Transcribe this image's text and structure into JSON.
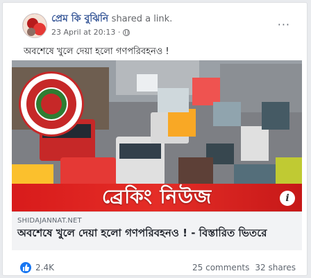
{
  "post": {
    "author": "প্রেম কি বুঝিনি",
    "action": "shared a link.",
    "date": "23 April at 20:13 ·",
    "menu_label": "···",
    "text": "অবশেষে খুলে দেয়া হলো গণপরিবহনও !"
  },
  "link": {
    "image_banner": "ব্রেকিং নিউজ",
    "info_label": "i",
    "domain": "SHIDAJANNAT.NET",
    "title": "অবশেষে খুলে দেয়া হলো গণপরিবহনও ! - বিস্তারিত ভিতরে"
  },
  "footer": {
    "likes": "2.4K",
    "comments": "25 comments",
    "shares": "32 shares"
  },
  "colors": {
    "author": "#385898",
    "banner": "#e52d27",
    "like": "#1877f2"
  }
}
